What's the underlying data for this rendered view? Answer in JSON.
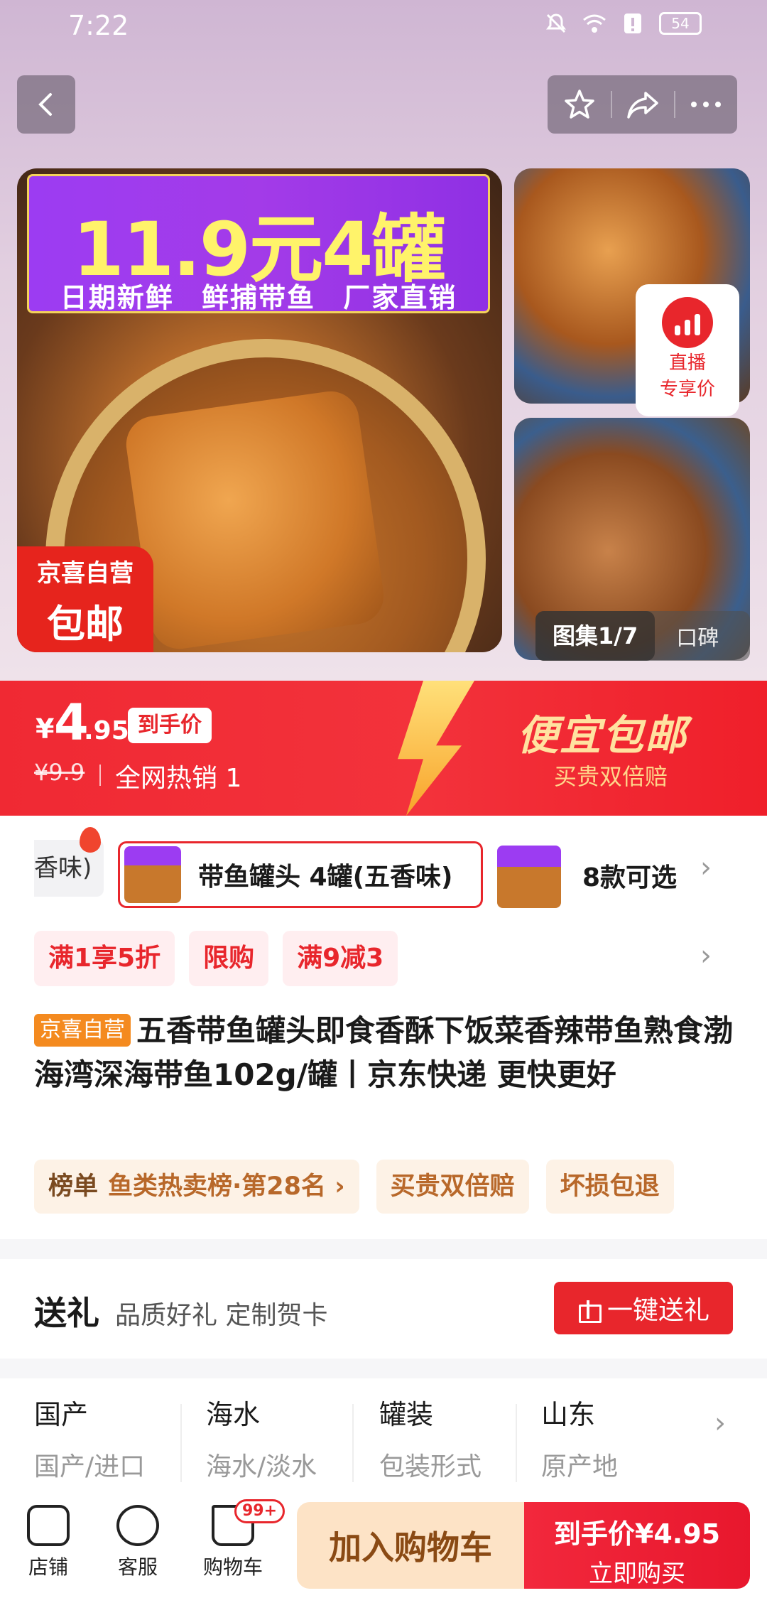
{
  "status": {
    "time": "7:22",
    "battery": "54"
  },
  "gallery": {
    "banner_title": "11.9元4罐",
    "banner_sub": "日期新鲜 鲜捕带鱼 厂家直销",
    "badge_line1": "京喜自营",
    "badge_line2": "包邮",
    "live_line1": "直播",
    "live_line2": "专享价",
    "tab_active": "图集1/7",
    "tab_other": "口碑"
  },
  "price": {
    "yen": "¥",
    "int": "4",
    "dec": ".95",
    "tag": "到手价",
    "original": "¥9.9",
    "hot": "全网热销 1",
    "watermark": "便宜包邮",
    "promo_title": "便宜包邮",
    "promo_sub": "买贵双倍赔"
  },
  "variants": {
    "prev_label": "香味)",
    "selected_label": "带鱼罐头 4罐(五香味)",
    "count_label": "8款可选"
  },
  "coupons": [
    "满1享5折",
    "限购",
    "满9减3"
  ],
  "product": {
    "badge": "京喜自营",
    "title": "五香带鱼罐头即食香酥下饭菜香辣带鱼熟食渤海湾深海带鱼102g/罐丨京东快递 更快更好"
  },
  "tags": {
    "rank_key": "榜单",
    "rank_value": "鱼类热卖榜·第28名",
    "tag2": "买贵双倍赔",
    "tag3": "坏损包退"
  },
  "gift": {
    "title": "送礼",
    "subtitle": "品质好礼 定制贺卡",
    "button": "一键送礼"
  },
  "attributes": [
    {
      "value": "国产",
      "key": "国产/进口"
    },
    {
      "value": "海水",
      "key": "海水/淡水"
    },
    {
      "value": "罐装",
      "key": "包装形式"
    },
    {
      "value": "山东",
      "key": "原产地"
    }
  ],
  "bottom": {
    "shop": "店铺",
    "service": "客服",
    "cart": "购物车",
    "cart_badge": "99+",
    "add_cart": "加入购物车",
    "buy_line1": "到手价¥4.95",
    "buy_line2": "立即购买"
  },
  "colors": {
    "accent": "#e8262c",
    "orange": "#f48a1f"
  }
}
